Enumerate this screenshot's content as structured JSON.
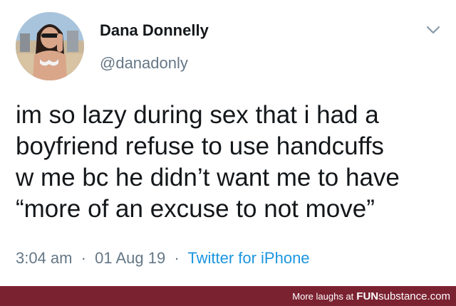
{
  "tweet": {
    "display_name": "Dana Donnelly",
    "handle": "@danadonly",
    "text_lines": [
      "im so lazy during sex that i had a",
      "boyfriend refuse to use handcuffs",
      "w me bc he didn’t want me to have",
      "“more of an excuse to not move”"
    ],
    "time": "3:04 am",
    "separator": "·",
    "date": "01 Aug 19",
    "source": "Twitter for iPhone",
    "menu_icon": "chevron-down-icon",
    "avatar_icon": "profile-photo"
  },
  "footer": {
    "prefix": "More laughs at",
    "brand": "FUN",
    "brand_rest": "substance.com"
  },
  "colors": {
    "footer_bg": "#7b2231",
    "link": "#1b95e0",
    "muted": "#657786",
    "text": "#14171a"
  }
}
